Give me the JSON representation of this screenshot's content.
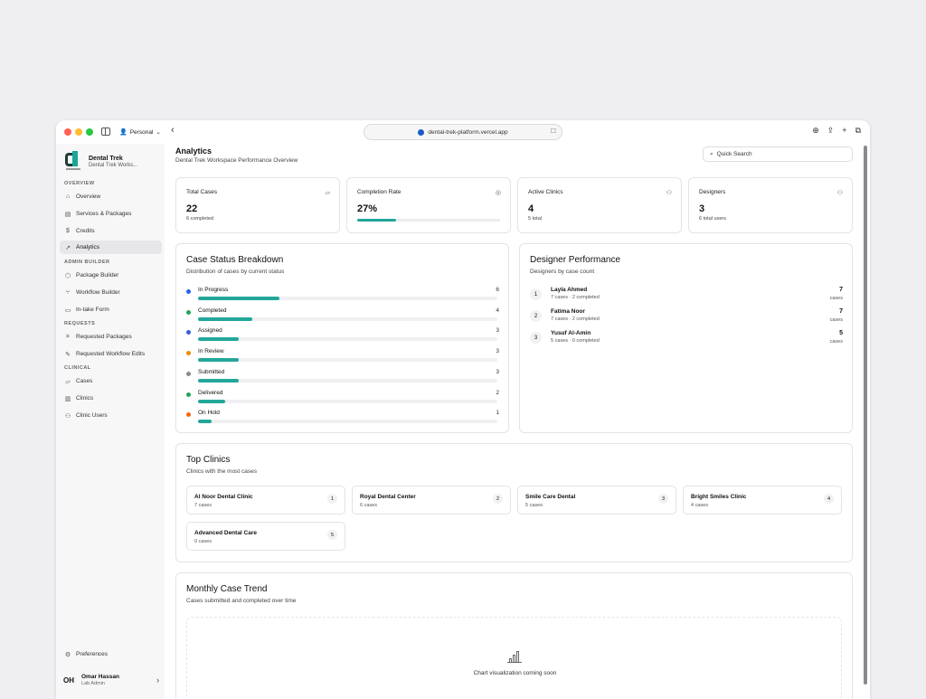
{
  "browser": {
    "profile": "Personal",
    "url": "dental-trek-platform.vercel.app"
  },
  "sidebar": {
    "brand_name": "Dental Trek",
    "brand_sub": "Dental Trek Works...",
    "sections": {
      "overview": "OVERVIEW",
      "admin_builder": "ADMIN BUILDER",
      "requests": "REQUESTS",
      "clinical": "CLINICAL"
    },
    "items": [
      {
        "label": "Overview",
        "icon": "home-icon"
      },
      {
        "label": "Services & Packages",
        "icon": "box-icon"
      },
      {
        "label": "Credits",
        "icon": "dollar-icon"
      },
      {
        "label": "Analytics",
        "icon": "trend-icon",
        "active": true
      },
      {
        "label": "Package Builder",
        "icon": "package-icon"
      },
      {
        "label": "Workflow Builder",
        "icon": "workflow-icon"
      },
      {
        "label": "In-take Form",
        "icon": "form-icon"
      },
      {
        "label": "Requested Packages",
        "icon": "tag-icon"
      },
      {
        "label": "Requested Workflow Edits",
        "icon": "edit-icon"
      },
      {
        "label": "Cases",
        "icon": "folder-icon"
      },
      {
        "label": "Clinics",
        "icon": "building-icon"
      },
      {
        "label": "Clinic Users",
        "icon": "users-icon"
      }
    ],
    "preferences": "Preferences",
    "user": {
      "initials": "OH",
      "name": "Omar Hassan",
      "role": "Lab Admin"
    }
  },
  "header": {
    "title": "Analytics",
    "subtitle": "Dental Trek Workspace Performance Overview",
    "search_placeholder": "Quick Search"
  },
  "stats": {
    "total_cases": {
      "label": "Total Cases",
      "value": "22",
      "sub": "6 completed"
    },
    "completion_rate": {
      "label": "Completion Rate",
      "value": "27%",
      "fraction": 0.27
    },
    "active_clinics": {
      "label": "Active Clinics",
      "value": "4",
      "sub": "5 total"
    },
    "designers": {
      "label": "Designers",
      "value": "3",
      "sub": "6 total users"
    }
  },
  "case_status": {
    "title": "Case Status Breakdown",
    "subtitle": "Distribution of cases by current status",
    "max": 22,
    "rows": [
      {
        "label": "In Progress",
        "count": 6,
        "color": "#2563eb"
      },
      {
        "label": "Completed",
        "count": 4,
        "color": "#22a45a"
      },
      {
        "label": "Assigned",
        "count": 3,
        "color": "#3b5bdb"
      },
      {
        "label": "In Review",
        "count": 3,
        "color": "#f08c00"
      },
      {
        "label": "Submitted",
        "count": 3,
        "color": "#8a8a8e"
      },
      {
        "label": "Delivered",
        "count": 2,
        "color": "#22a45a"
      },
      {
        "label": "On Hold",
        "count": 1,
        "color": "#f76707"
      }
    ]
  },
  "designer_performance": {
    "title": "Designer Performance",
    "subtitle": "Designers by case count",
    "unit": "cases",
    "rows": [
      {
        "rank": "1",
        "name": "Layla Ahmed",
        "sub": "7 cases · 2 completed",
        "count": "7"
      },
      {
        "rank": "2",
        "name": "Fatima Noor",
        "sub": "7 cases · 2 completed",
        "count": "7"
      },
      {
        "rank": "3",
        "name": "Yusuf Al-Amin",
        "sub": "5 cases · 0 completed",
        "count": "5"
      }
    ]
  },
  "top_clinics": {
    "title": "Top Clinics",
    "subtitle": "Clinics with the most cases",
    "clinics": [
      {
        "name": "Al Noor Dental Clinic",
        "cases": "7 cases",
        "rank": "1"
      },
      {
        "name": "Royal Dental Center",
        "cases": "6 cases",
        "rank": "2"
      },
      {
        "name": "Smile Care Dental",
        "cases": "5 cases",
        "rank": "3"
      },
      {
        "name": "Bright Smiles Clinic",
        "cases": "4 cases",
        "rank": "4"
      },
      {
        "name": "Advanced Dental Care",
        "cases": "0 cases",
        "rank": "5"
      }
    ]
  },
  "monthly_trend": {
    "title": "Monthly Case Trend",
    "subtitle": "Cases submitted and completed over time",
    "placeholder": "Chart visualization coming soon"
  }
}
